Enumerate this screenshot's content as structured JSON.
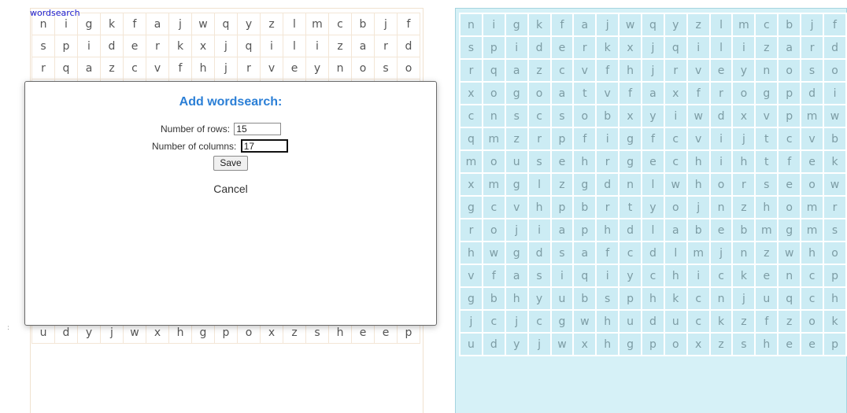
{
  "left_panel": {
    "label": "wordsearch"
  },
  "grid": {
    "columns": 17,
    "rows": [
      [
        "n",
        "i",
        "g",
        "k",
        "f",
        "a",
        "j",
        "w",
        "q",
        "y",
        "z",
        "l",
        "m",
        "c",
        "b",
        "j",
        "f"
      ],
      [
        "s",
        "p",
        "i",
        "d",
        "e",
        "r",
        "k",
        "x",
        "j",
        "q",
        "i",
        "l",
        "i",
        "z",
        "a",
        "r",
        "d"
      ],
      [
        "r",
        "q",
        "a",
        "z",
        "c",
        "v",
        "f",
        "h",
        "j",
        "r",
        "v",
        "e",
        "y",
        "n",
        "o",
        "s",
        "o"
      ],
      [
        "x",
        "o",
        "g",
        "o",
        "a",
        "t",
        "v",
        "f",
        "a",
        "x",
        "f",
        "r",
        "o",
        "g",
        "p",
        "d",
        "i"
      ],
      [
        "c",
        "n",
        "s",
        "c",
        "s",
        "o",
        "b",
        "x",
        "y",
        "i",
        "w",
        "d",
        "x",
        "v",
        "p",
        "m",
        "w"
      ],
      [
        "q",
        "m",
        "z",
        "r",
        "p",
        "f",
        "i",
        "g",
        "f",
        "c",
        "v",
        "i",
        "j",
        "t",
        "c",
        "v",
        "b"
      ],
      [
        "m",
        "o",
        "u",
        "s",
        "e",
        "h",
        "r",
        "g",
        "e",
        "c",
        "h",
        "i",
        "h",
        "t",
        "f",
        "e",
        "k"
      ],
      [
        "x",
        "m",
        "g",
        "l",
        "z",
        "g",
        "d",
        "n",
        "l",
        "w",
        "h",
        "o",
        "r",
        "s",
        "e",
        "o",
        "w"
      ],
      [
        "g",
        "c",
        "v",
        "h",
        "p",
        "b",
        "r",
        "t",
        "y",
        "o",
        "j",
        "n",
        "z",
        "h",
        "o",
        "m",
        "r"
      ],
      [
        "r",
        "o",
        "j",
        "i",
        "a",
        "p",
        "h",
        "d",
        "l",
        "a",
        "b",
        "e",
        "b",
        "m",
        "g",
        "m",
        "s"
      ],
      [
        "h",
        "w",
        "g",
        "d",
        "s",
        "a",
        "f",
        "c",
        "d",
        "l",
        "m",
        "j",
        "n",
        "z",
        "w",
        "h",
        "o"
      ],
      [
        "v",
        "f",
        "a",
        "s",
        "i",
        "q",
        "i",
        "y",
        "c",
        "h",
        "i",
        "c",
        "k",
        "e",
        "n",
        "c",
        "p"
      ],
      [
        "g",
        "b",
        "h",
        "y",
        "u",
        "b",
        "s",
        "p",
        "h",
        "k",
        "c",
        "n",
        "j",
        "u",
        "q",
        "c",
        "h"
      ],
      [
        "j",
        "c",
        "j",
        "c",
        "g",
        "w",
        "h",
        "u",
        "d",
        "u",
        "c",
        "k",
        "z",
        "f",
        "z",
        "o",
        "k"
      ],
      [
        "u",
        "d",
        "y",
        "j",
        "w",
        "x",
        "h",
        "g",
        "p",
        "o",
        "x",
        "z",
        "s",
        "h",
        "e",
        "e",
        "p"
      ]
    ]
  },
  "left_visible_rows": [
    0,
    1,
    2,
    12,
    13,
    14
  ],
  "modal": {
    "title": "Add wordsearch:",
    "rows_label": "Number of rows:",
    "rows_value": "15",
    "columns_label": "Number of columns:",
    "columns_value": "17",
    "save_label": "Save",
    "cancel_label": "Cancel"
  },
  "colors": {
    "title_blue": "#2b7fd6",
    "right_grid_bg": "#d6f1f7",
    "right_cell_bg": "#ccecf4"
  }
}
